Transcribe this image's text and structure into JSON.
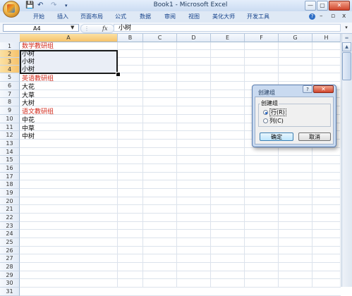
{
  "window": {
    "title": "Book1 - Microsoft Excel",
    "quick_access": [
      "💾",
      "↶",
      "↷"
    ],
    "controls": {
      "minimize": "—",
      "restore": "▢",
      "close": "✕"
    },
    "ribbon_controls": {
      "help": "?",
      "minimize": "–",
      "restore": "▫",
      "close": "x"
    }
  },
  "ribbon": {
    "tabs": [
      "开始",
      "插入",
      "页面布局",
      "公式",
      "数据",
      "审阅",
      "视图",
      "美化大师",
      "开发工具"
    ]
  },
  "formula_bar": {
    "name_box": "A4",
    "fx": "fx",
    "value": "小树"
  },
  "sheet": {
    "columns": [
      "A",
      "B",
      "C",
      "D",
      "E",
      "F",
      "G",
      "H"
    ],
    "rows": [
      "1",
      "2",
      "3",
      "4",
      "5",
      "6",
      "7",
      "8",
      "9",
      "10",
      "11",
      "12",
      "13",
      "14",
      "15",
      "16",
      "17",
      "18",
      "19",
      "20",
      "21",
      "22",
      "23",
      "24",
      "25",
      "26",
      "27",
      "28",
      "29",
      "30",
      "31"
    ],
    "cells": {
      "A1": "数学教研组",
      "A2": "小树",
      "A3": "小树",
      "A4": "小树",
      "A5": "英语教研组",
      "A6": "大花",
      "A7": "大草",
      "A8": "大树",
      "A9": "语文教研组",
      "A10": "中花",
      "A11": "中草",
      "A12": "中树"
    },
    "heading_color": "#d22c1e"
  },
  "dialog": {
    "title": "创建组",
    "help": "?",
    "close": "✕",
    "group_label": "创建组",
    "options": [
      {
        "label": "行(R)",
        "selected": true
      },
      {
        "label": "列(C)",
        "selected": false
      }
    ],
    "ok": "确定",
    "cancel": "取消"
  }
}
